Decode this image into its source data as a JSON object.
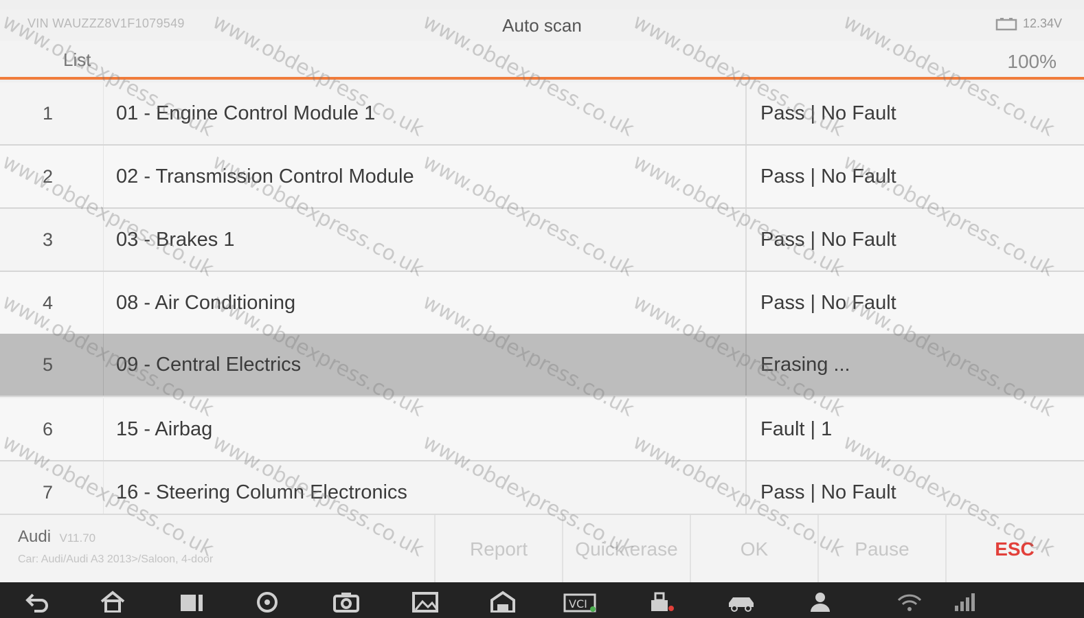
{
  "header": {
    "vin": "VIN WAUZZZ8V1F1079549",
    "title": "Auto scan",
    "battery_voltage": "12.34V"
  },
  "list_header": {
    "label": "List",
    "progress": "100%"
  },
  "rows": [
    {
      "num": "1",
      "name": "01 - Engine Control Module 1",
      "status": "Pass | No Fault"
    },
    {
      "num": "2",
      "name": "02 - Transmission Control Module",
      "status": "Pass | No Fault"
    },
    {
      "num": "3",
      "name": "03 - Brakes 1",
      "status": "Pass | No Fault"
    },
    {
      "num": "4",
      "name": "08 - Air Conditioning",
      "status": "Pass | No Fault"
    },
    {
      "num": "5",
      "name": "09 - Central Electrics",
      "status": "Erasing ..."
    },
    {
      "num": "6",
      "name": "15 - Airbag",
      "status": "Fault | 1"
    },
    {
      "num": "7",
      "name": "16 - Steering Column Electronics",
      "status": "Pass | No Fault"
    }
  ],
  "footer": {
    "brand": "Audi",
    "version": "V11.70",
    "car": "Car: Audi/Audi A3 2013>/Saloon, 4-door",
    "buttons": {
      "report": "Report",
      "quick_erase": "Quick erase",
      "ok": "OK",
      "pause": "Pause",
      "esc": "ESC"
    }
  },
  "watermark": "www.obdexpress.co.uk",
  "colors": {
    "accent_line": "#f07c3c",
    "esc": "#e2403a",
    "active_row": "#bdbdbd"
  }
}
